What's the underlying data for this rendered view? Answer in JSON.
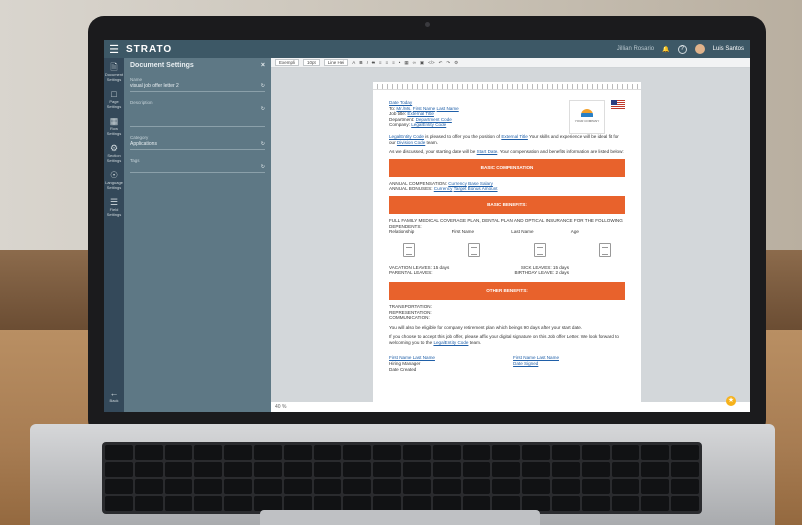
{
  "app": {
    "logo": "STRATO",
    "user_name": "Luis Santos",
    "team_label": "Jillian Rosario"
  },
  "left_nav": [
    {
      "label": "Document Settings",
      "icon": "document-icon"
    },
    {
      "label": "Page Settings",
      "icon": "page-icon"
    },
    {
      "label": "Row Settings",
      "icon": "grid-icon"
    },
    {
      "label": "Section Settings",
      "icon": "section-icon"
    },
    {
      "label": "Language Settings",
      "icon": "globe-icon"
    },
    {
      "label": "Field Settings",
      "icon": "list-icon"
    },
    {
      "label": "Back",
      "icon": "back-arrow-icon"
    }
  ],
  "panel": {
    "title": "Document Settings",
    "name_label": "Name",
    "name_value": "visual job offer letter 2",
    "description_label": "Description",
    "category_label": "Category",
    "category_value": "Applications",
    "tags_label": "Tags"
  },
  "toolbar": {
    "font_select": "Exempli",
    "size_select": "10pt",
    "line_select": "Line Hei"
  },
  "status": {
    "zoom": "40 %"
  },
  "document": {
    "date": "Date Today",
    "to_prefix": "To:",
    "to_salutation": "Mr./Ms.",
    "to_first": "First Name",
    "to_last": "Last Name",
    "job_title_label": "Job title:",
    "job_title": "External Title",
    "department_label": "Department:",
    "department": "Department Code",
    "company_label": "Company:",
    "company": "LegalEntity Code",
    "logo_text": "YOUR COMPANY",
    "para1_a": "LegalEntity Code",
    "para1_b": "is pleased to offer you the position of",
    "para1_c": "External Title",
    "para1_d": "Your skills and experience will be ideal fit for our",
    "para1_e": "Division Code",
    "para1_f": "team.",
    "para2_a": "As we discussed, your starting date will be",
    "para2_b": "Start Date",
    "para2_c": ". Your compensation and benefits information are listed below:",
    "basic_comp": "BASIC COMPENSATION",
    "annual_comp_label": "ANNUAL COMPENSATION:",
    "annual_comp_cur": "Currency",
    "annual_comp_val": "Base Salary",
    "annual_bonus_label": "ANNUAL BONUSES:",
    "annual_bonus_cur": "Currency",
    "annual_bonus_val": "Target Bonus Amount",
    "basic_benefits": "BASIC BENEFITS:",
    "coverage": "FULL FAMILY MEDICAL COVERAGE PLAN, DENTAL PLAN AND OPTICAL INSURANCE FOR THE FOLLOWING DEPENDENTS:",
    "col_relationship": "Relationship",
    "col_first": "First Name",
    "col_last": "Last Name",
    "col_age": "Age",
    "vacation": "VACATION LEAVES: 15 days",
    "parental": "PARENTAL LEAVES:",
    "sick": "SICK LEAVES: 15 days",
    "birthday": "BIRTHDAY LEAVE: 2 days",
    "other_benefits": "OTHER BENEFITS:",
    "transport": "TRANSPORTATION:",
    "representation": "REPRESENTATION:",
    "communication": "COMMUNICATION:",
    "retirement": "You will also be eligible for company retirement plan which beings 90 days after your start date.",
    "accept_a": "If you choose to accept this job offer, please affix your digital signature on this Job offer Letter. We look forward to welcoming you to the",
    "accept_b": "LegalEntity Code",
    "accept_c": "team.",
    "sig_left_name": "First Name Last Name",
    "sig_left_role": "Hiring Manager",
    "sig_left_date": "Date Created",
    "sig_right_name": "First Name Last Name",
    "sig_right_date": "Date Signed"
  }
}
